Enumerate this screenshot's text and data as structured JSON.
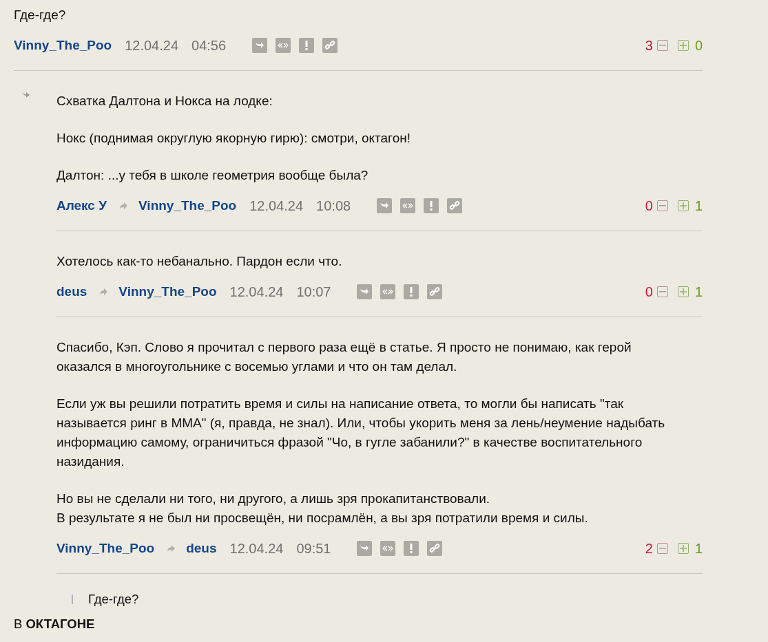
{
  "comments": [
    {
      "nested": false,
      "marker": false,
      "paragraphs": [
        "Где-где?"
      ],
      "author": "Vinny_The_Poo",
      "date": "12.04.24",
      "time": "04:56",
      "minus": "3",
      "plus": "0"
    },
    {
      "nested": true,
      "marker": true,
      "paragraphs": [
        "Схватка Далтона и Нокса на лодке:",
        "Нокс (поднимая округлую якорную гирю): смотри, октагон!",
        "Далтон: ...у тебя в школе геометрия вообще была?"
      ],
      "author": "Алекс У",
      "reply_to": "Vinny_The_Poo",
      "date": "12.04.24",
      "time": "10:08",
      "minus": "0",
      "plus": "1"
    },
    {
      "nested": true,
      "marker": false,
      "paragraphs": [
        "Хотелось как-то небанально. Пардон если что."
      ],
      "author": "deus",
      "reply_to": "Vinny_The_Poo",
      "date": "12.04.24",
      "time": "10:07",
      "minus": "0",
      "plus": "1"
    },
    {
      "nested": true,
      "marker": false,
      "paragraphs": [
        "Спасибо, Кэп. Слово я прочитал с первого раза ещё в статье. Я просто не понимаю, как герой оказался в многоугольнике с восемью углами и что он там делал.",
        "Если уж вы решили потратить время и силы на написание ответа, то могли бы написать \"так называется ринг в ММА\" (я, правда, не знал). Или, чтобы укорить меня за лень/неумение надыбать информацию самому, ограничиться фразой \"Чо, в гугле забанили?\" в качестве воспитательного назидания.",
        "Но вы не сделали ни того, ни другого, а лишь зря прокапитанствовали.\nВ результате я не был ни просвещён, ни посрамлён, а вы зря потратили время и силы."
      ],
      "author": "Vinny_The_Poo",
      "reply_to": "deus",
      "date": "12.04.24",
      "time": "09:51",
      "minus": "2",
      "plus": "1"
    }
  ],
  "next_comment": {
    "quote": "Где-где?",
    "text": "В **ОКТАГОНЕ**"
  }
}
